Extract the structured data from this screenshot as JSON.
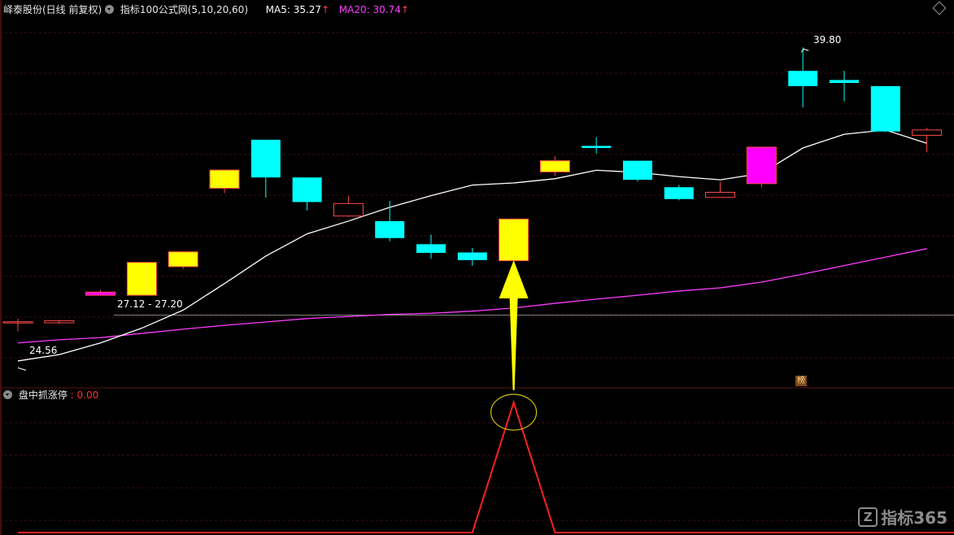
{
  "header": {
    "stock_title": "峄泰股份(日线 前复权)",
    "indicator_title": "指标100公式网(5,10,20,60)",
    "ma5_label": "MA5: 35.27",
    "ma20_label": "MA20: 30.74",
    "up_arrow": "↑"
  },
  "annotations": {
    "high_price": "39.80",
    "low_price": "24.56",
    "range_label": "27.12 - 27.20",
    "bang_badge": "榜"
  },
  "sub_panel": {
    "title": "盘中抓涨停",
    "value": ": 0.00"
  },
  "watermark": {
    "icon": "Z",
    "text": "指标365"
  },
  "colors": {
    "up_hollow": "#ff4a4a",
    "yellow": "#ffff00",
    "cyan": "#00ffff",
    "magenta": "#ff00ff",
    "ma5": "#ffffff",
    "ma20": "#ff3cff",
    "signal": "#ff2020"
  },
  "chart_data": {
    "type": "candlestick",
    "price_range": [
      24.0,
      40.5
    ],
    "candles": [
      {
        "open": 26.85,
        "close": 26.8,
        "high": 27.0,
        "low": 26.4,
        "fill": "hollow"
      },
      {
        "open": 26.9,
        "close": 26.8,
        "high": 26.8,
        "low": 26.75,
        "fill": "hollow"
      },
      {
        "open": 28.25,
        "close": 28.1,
        "high": 28.35,
        "low": 28.2,
        "fill": "magenta"
      },
      {
        "open": 28.1,
        "close": 29.65,
        "high": 29.65,
        "low": 28.1,
        "fill": "yellow"
      },
      {
        "open": 29.45,
        "close": 30.15,
        "high": 30.18,
        "low": 29.35,
        "fill": "yellow"
      },
      {
        "open": 33.15,
        "close": 34.01,
        "high": 34.01,
        "low": 32.92,
        "fill": "yellow"
      },
      {
        "open": 35.44,
        "close": 33.66,
        "high": 35.44,
        "low": 32.71,
        "fill": "cyan"
      },
      {
        "open": 33.66,
        "close": 32.5,
        "high": 33.66,
        "low": 32.1,
        "fill": "cyan"
      },
      {
        "open": 32.43,
        "close": 31.84,
        "high": 32.8,
        "low": 31.8,
        "fill": "hollow"
      },
      {
        "open": 31.6,
        "close": 30.8,
        "high": 32.55,
        "low": 30.65,
        "fill": "cyan"
      },
      {
        "open": 30.51,
        "close": 30.1,
        "high": 30.96,
        "low": 29.82,
        "fill": "cyan"
      },
      {
        "open": 30.12,
        "close": 29.76,
        "high": 30.33,
        "low": 29.49,
        "fill": "cyan"
      },
      {
        "open": 29.73,
        "close": 31.7,
        "high": 31.72,
        "low": 29.58,
        "fill": "yellow"
      },
      {
        "open": 33.92,
        "close": 34.45,
        "high": 34.66,
        "low": 33.73,
        "fill": "yellow"
      },
      {
        "open": 35.15,
        "close": 35.05,
        "high": 35.56,
        "low": 34.79,
        "fill": "cyan"
      },
      {
        "open": 34.45,
        "close": 33.55,
        "high": 34.45,
        "low": 33.47,
        "fill": "cyan"
      },
      {
        "open": 33.2,
        "close": 32.64,
        "high": 33.31,
        "low": 32.58,
        "fill": "cyan"
      },
      {
        "open": 32.96,
        "close": 32.72,
        "high": 33.45,
        "low": 32.72,
        "fill": "hollow"
      },
      {
        "open": 33.37,
        "close": 35.09,
        "high": 35.09,
        "low": 33.2,
        "fill": "magenta"
      },
      {
        "open": 38.69,
        "close": 37.97,
        "high": 39.8,
        "low": 36.97,
        "fill": "cyan"
      },
      {
        "open": 38.26,
        "close": 38.12,
        "high": 38.69,
        "low": 37.25,
        "fill": "cyan"
      },
      {
        "open": 37.97,
        "close": 35.83,
        "high": 37.97,
        "low": 35.8,
        "fill": "cyan"
      },
      {
        "open": 35.9,
        "close": 35.65,
        "high": 36.0,
        "low": 34.85,
        "fill": "hollow"
      }
    ],
    "ma5": [
      25.0,
      25.3,
      25.85,
      26.55,
      27.4,
      28.65,
      29.95,
      31.0,
      31.6,
      32.25,
      32.8,
      33.3,
      33.4,
      33.6,
      34.0,
      33.9,
      33.7,
      33.55,
      33.85,
      35.05,
      35.7,
      35.9,
      35.27
    ],
    "ma20": [
      25.85,
      26.0,
      26.1,
      26.3,
      26.5,
      26.68,
      26.84,
      27.0,
      27.1,
      27.2,
      27.25,
      27.35,
      27.5,
      27.72,
      27.92,
      28.1,
      28.3,
      28.45,
      28.72,
      29.1,
      29.5,
      29.9,
      30.3
    ],
    "signal": [
      0,
      0,
      0,
      0,
      0,
      0,
      0,
      0,
      0,
      0,
      0,
      0,
      1,
      0,
      0,
      0,
      0,
      0,
      0,
      0,
      0,
      0,
      0
    ],
    "horizontal_line": 27.16,
    "grid": true
  }
}
